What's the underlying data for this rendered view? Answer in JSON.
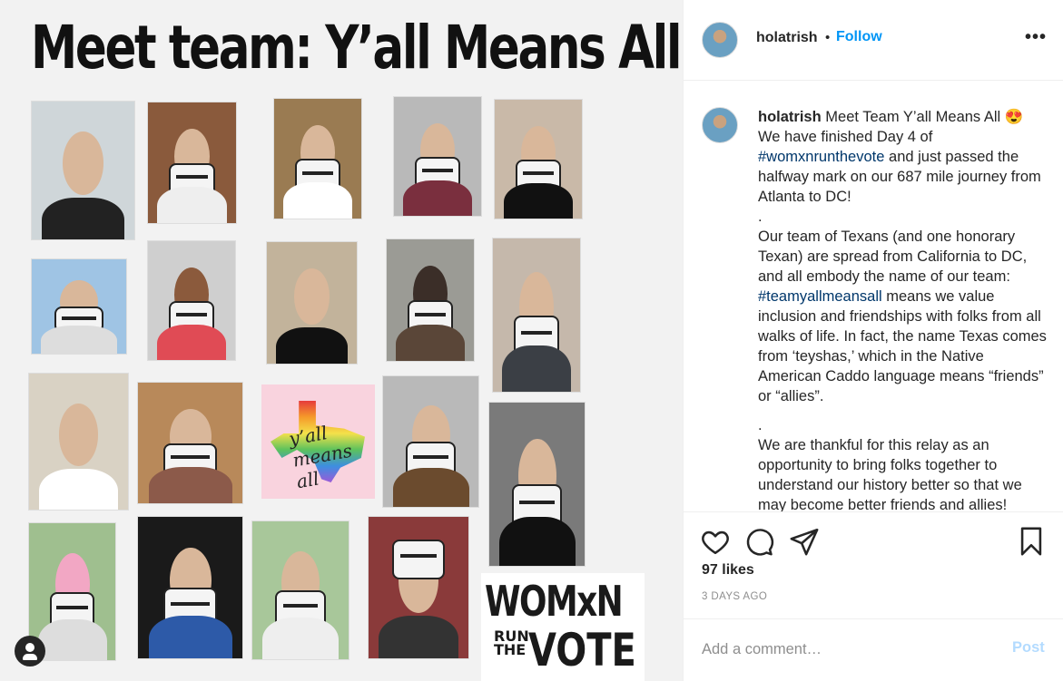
{
  "post_image": {
    "title": "Meet team: Y’all Means All",
    "sticker_text": "y’all means all",
    "logo": {
      "line1": "WOMxN",
      "line2a": "RUN",
      "line2b": "THE",
      "line3": "VOTE"
    },
    "colors": {
      "title": "#111111",
      "sticker_bg": "#f9d3de"
    }
  },
  "header": {
    "username": "holatrish",
    "separator": "•",
    "follow_label": "Follow",
    "more_icon": "more-horizontal-icon"
  },
  "caption": {
    "username": "holatrish",
    "line1": "Meet Team Y’all Means All 😍",
    "p1_pre": "We have finished Day 4 of",
    "hashtag1": "#womxnrunthevote",
    "p1_post": "and just passed the halfway mark on our 687 mile journey from Atlanta to DC!",
    "dot1": ".",
    "p2_pre": "Our team of Texans (and one honorary Texan) are spread from California to DC, and all embody the name of our team:",
    "hashtag2": "#teamyallmeansall",
    "p2_post": "means we value inclusion and friendships with folks from all walks of life. In fact, the name Texas comes from ‘teyshas,’ which in the Native American Caddo language means “friends” or “allies”.",
    "dot2": ".",
    "p3": "We are thankful for this relay as an opportunity to bring folks together to understand our history better so that we may become better friends and allies!"
  },
  "actions": {
    "like_icon": "heart-icon",
    "comment_icon": "comment-bubble-icon",
    "share_icon": "paper-plane-icon",
    "save_icon": "bookmark-icon",
    "likes": "97 likes",
    "date": "3 DAYS AGO"
  },
  "comment": {
    "placeholder": "Add a comment…",
    "post_label": "Post"
  },
  "colors": {
    "accent": "#0095f6",
    "hashtag": "#00376b",
    "muted": "#8e8e8e",
    "post_disabled": "#b3dbff"
  }
}
